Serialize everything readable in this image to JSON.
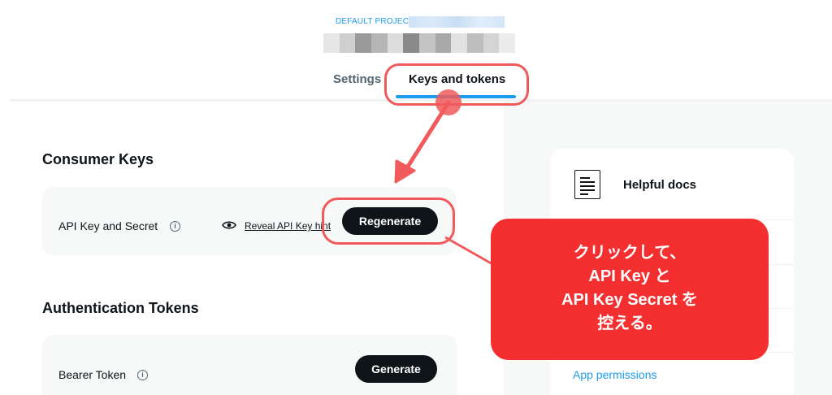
{
  "header": {
    "project_label": "DEFAULT PROJECT-",
    "tabs": [
      {
        "label": "Settings",
        "active": false
      },
      {
        "label": "Keys and tokens",
        "active": true
      }
    ]
  },
  "consumer_keys": {
    "title": "Consumer Keys",
    "api_key_row": {
      "label": "API Key and Secret",
      "info_icon": "info-circle-icon",
      "reveal_icon": "eye-icon",
      "reveal_link": "Reveal API Key hint",
      "button": "Regenerate"
    }
  },
  "auth_tokens": {
    "title": "Authentication Tokens",
    "bearer_row": {
      "label": "Bearer Token",
      "info_icon": "info-circle-icon",
      "button": "Generate"
    }
  },
  "sidebar": {
    "docs_icon": "document-icon",
    "docs_title": "Helpful docs",
    "link_app_permissions": "App permissions"
  },
  "annotation": {
    "lines": [
      "クリックして、",
      "API Key と",
      "API Key Secret を",
      "控える。"
    ],
    "color": "#f42f2f",
    "outline_color": "#f05a5a"
  },
  "colors": {
    "accent": "#1d9bf0",
    "button_bg": "#0f1419",
    "card_bg": "#f7f9f9"
  }
}
